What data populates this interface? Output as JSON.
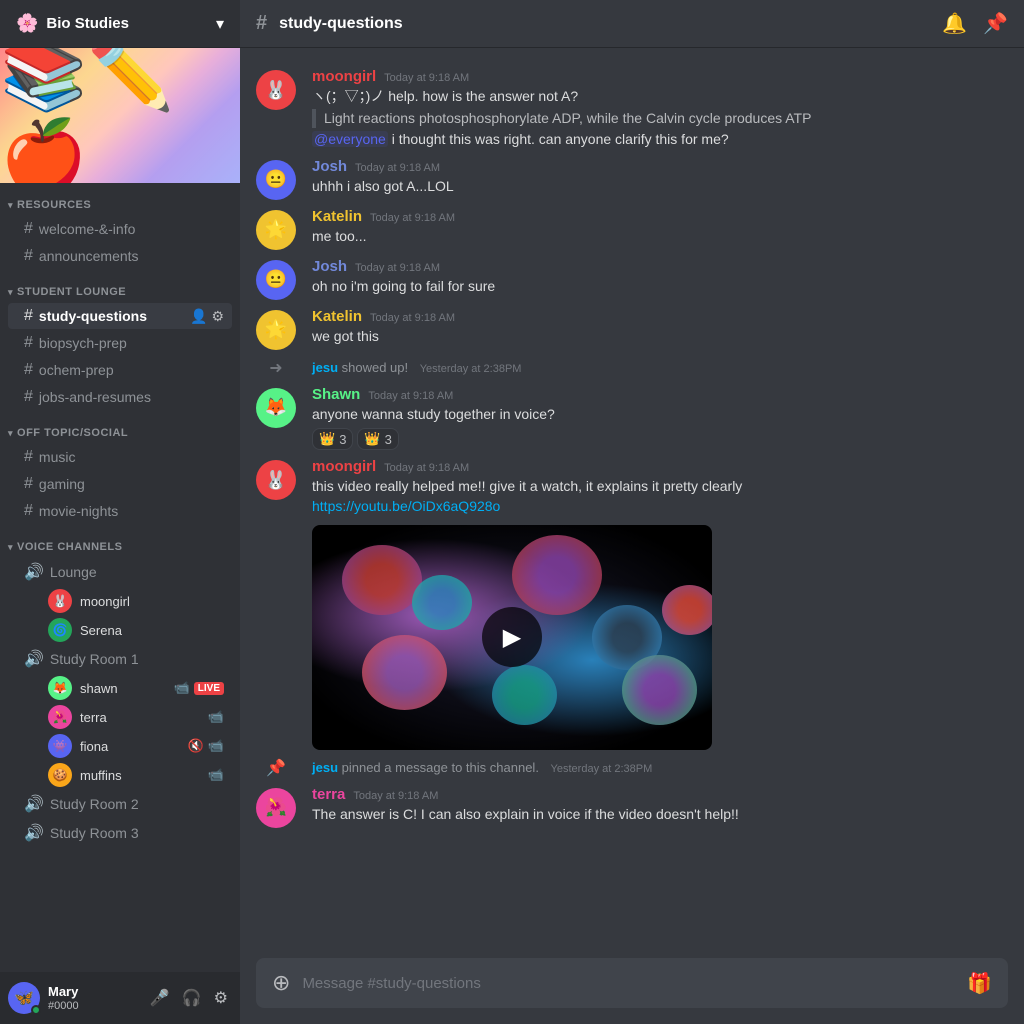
{
  "server": {
    "name": "Bio Studies",
    "dropdown_label": "▾"
  },
  "sidebar": {
    "categories": [
      {
        "name": "RESOURCES",
        "channels": [
          {
            "id": "welcome",
            "type": "text",
            "label": "welcome-&-info"
          },
          {
            "id": "announcements",
            "type": "text",
            "label": "announcements"
          }
        ]
      },
      {
        "name": "STUDENT LOUNGE",
        "channels": [
          {
            "id": "study-questions",
            "type": "text",
            "label": "study-questions",
            "active": true
          },
          {
            "id": "biopsych-prep",
            "type": "text",
            "label": "biopsych-prep"
          },
          {
            "id": "ochem-prep",
            "type": "text",
            "label": "ochem-prep"
          },
          {
            "id": "jobs-and-resumes",
            "type": "text",
            "label": "jobs-and-resumes"
          }
        ]
      },
      {
        "name": "OFF TOPIC/SOCIAL",
        "channels": [
          {
            "id": "music",
            "type": "text",
            "label": "music"
          },
          {
            "id": "gaming",
            "type": "text",
            "label": "gaming"
          },
          {
            "id": "movie-nights",
            "type": "text",
            "label": "movie-nights"
          }
        ]
      }
    ],
    "voice_section": {
      "name": "VOICE CHANNELS",
      "channels": [
        {
          "id": "lounge",
          "label": "Lounge",
          "users": [
            {
              "name": "moongirl",
              "avatar_color": "#ed4245",
              "emoji": "🐰"
            },
            {
              "name": "Serena",
              "avatar_color": "#23a55a",
              "emoji": "🌀"
            }
          ]
        },
        {
          "id": "study-room-1",
          "label": "Study Room 1",
          "users": [
            {
              "name": "shawn",
              "avatar_color": "#57f287",
              "emoji": "🦊",
              "live": true,
              "has_video": true
            },
            {
              "name": "terra",
              "avatar_color": "#eb459e",
              "emoji": "🌺",
              "has_video": true
            },
            {
              "name": "fiona",
              "avatar_color": "#5865f2",
              "emoji": "👾",
              "muted": true,
              "has_video": true
            },
            {
              "name": "muffins",
              "avatar_color": "#faa61a",
              "emoji": "🍪",
              "has_video": true
            }
          ]
        },
        {
          "id": "study-room-2",
          "label": "Study Room 2",
          "users": []
        },
        {
          "id": "study-room-3",
          "label": "Study Room 3",
          "users": []
        }
      ]
    }
  },
  "user": {
    "name": "Mary",
    "tag": "#0000",
    "avatar_emoji": "🦋",
    "status": "online"
  },
  "chat": {
    "channel_name": "study-questions",
    "messages": [
      {
        "id": "msg1",
        "author": "moongirl",
        "author_color": "#ed4245",
        "avatar_emoji": "🐰",
        "avatar_color": "#ed4245",
        "timestamp": "Today at 9:18 AM",
        "text": "ヽ(；▽；)ノ help. how is the answer not A?",
        "quote": "Light reactions photosphosphorylate ADP, while the Calvin cycle produces ATP",
        "extra": "@everyone i thought this was right. can anyone clarify this for me?"
      },
      {
        "id": "msg2",
        "author": "Josh",
        "author_color": "#7289da",
        "avatar_emoji": "😐",
        "avatar_color": "#5865f2",
        "timestamp": "Today at 9:18 AM",
        "text": "uhhh i also got A...LOL"
      },
      {
        "id": "msg3",
        "author": "Katelin",
        "author_color": "#f0c330",
        "avatar_emoji": "🌟",
        "avatar_color": "#f0c330",
        "timestamp": "Today at 9:18 AM",
        "text": "me too..."
      },
      {
        "id": "msg4",
        "author": "Josh",
        "author_color": "#7289da",
        "avatar_emoji": "😐",
        "avatar_color": "#5865f2",
        "timestamp": "Today at 9:18 AM",
        "text": "oh no i'm going to fail for sure"
      },
      {
        "id": "msg5",
        "author": "Katelin",
        "author_color": "#f0c330",
        "avatar_emoji": "🌟",
        "avatar_color": "#f0c330",
        "timestamp": "Today at 9:18 AM",
        "text": "we got this"
      },
      {
        "id": "sys1",
        "type": "system",
        "actor": "jesu",
        "action": "showed up!",
        "timestamp": "Yesterday at 2:38PM"
      },
      {
        "id": "msg6",
        "author": "Shawn",
        "author_color": "#57f287",
        "avatar_emoji": "🦊",
        "avatar_color": "#57f287",
        "timestamp": "Today at 9:18 AM",
        "text": "anyone wanna study together in voice?",
        "reactions": [
          {
            "emoji": "👑",
            "count": 3
          },
          {
            "emoji": "👑",
            "count": 3
          }
        ]
      },
      {
        "id": "msg7",
        "author": "moongirl",
        "author_color": "#ed4245",
        "avatar_emoji": "🐰",
        "avatar_color": "#ed4245",
        "timestamp": "Today at 9:18 AM",
        "text": "this video really helped me!! give it a watch, it explains it pretty clearly",
        "link": "https://youtu.be/OiDx6aQ928o",
        "has_video": true
      },
      {
        "id": "sys2",
        "type": "system_pin",
        "actor": "jesu",
        "action": "pinned a message to this channel.",
        "timestamp": "Yesterday at 2:38PM"
      },
      {
        "id": "msg8",
        "author": "terra",
        "author_color": "#eb459e",
        "avatar_emoji": "🌺",
        "avatar_color": "#eb459e",
        "timestamp": "Today at 9:18 AM",
        "text": "The answer is C! I can also explain in voice if the video doesn't help!!"
      }
    ],
    "input_placeholder": "Message #study-questions"
  }
}
